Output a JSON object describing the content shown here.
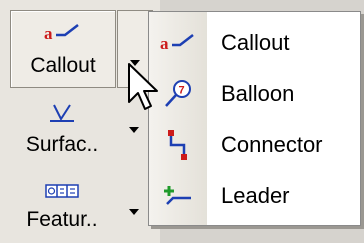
{
  "toolbar": {
    "buttons": [
      {
        "label": "Callout",
        "icon": "callout-icon"
      },
      {
        "label": "Surfac..",
        "icon": "surface-finish-icon"
      },
      {
        "label": "Featur..",
        "icon": "feature-control-icon"
      }
    ]
  },
  "menu": {
    "items": [
      {
        "label": "Callout",
        "icon": "callout-icon"
      },
      {
        "label": "Balloon",
        "icon": "balloon-icon"
      },
      {
        "label": "Connector",
        "icon": "connector-icon"
      },
      {
        "label": "Leader",
        "icon": "leader-icon"
      }
    ]
  },
  "colors": {
    "icon_red": "#cc1b1b",
    "icon_blue": "#1d3fb3",
    "icon_green": "#1f9a2a"
  }
}
